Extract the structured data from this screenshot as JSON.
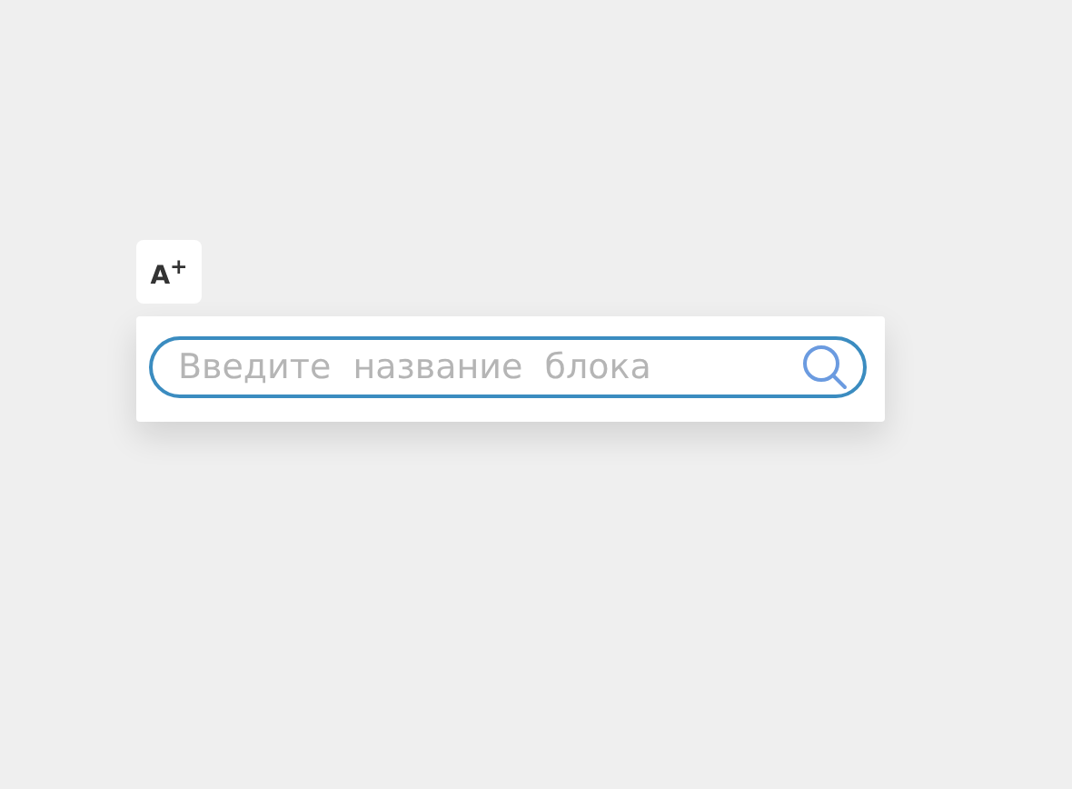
{
  "add_text_button": {
    "label": "A$^{+}$"
  },
  "search": {
    "placeholder": "Введите  название  блока"
  }
}
